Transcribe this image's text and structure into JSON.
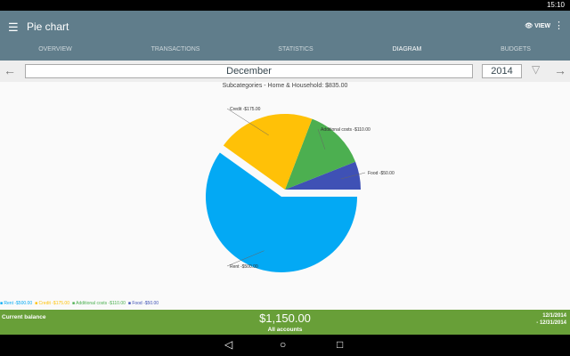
{
  "status": {
    "time": "15:10"
  },
  "appbar": {
    "title": "Pie chart",
    "view_label": "VIEW"
  },
  "tabs": [
    {
      "label": "OVERVIEW"
    },
    {
      "label": "TRANSACTIONS"
    },
    {
      "label": "STATISTICS"
    },
    {
      "label": "DIAGRAM"
    },
    {
      "label": "BUDGETS"
    }
  ],
  "period": {
    "month": "December",
    "year": "2014"
  },
  "chart_data": {
    "type": "pie",
    "title": "Subcategories - Home & Household: $835.00",
    "slices": [
      {
        "name": "Food",
        "value": 50,
        "label": "Food -$50.00",
        "color": "#3f51b5"
      },
      {
        "name": "Additional costs",
        "value": 110,
        "label": "Additional costs -$110.00",
        "color": "#4caf50"
      },
      {
        "name": "Credit",
        "value": 175,
        "label": "Credit -$175.00",
        "color": "#ffc107"
      },
      {
        "name": "Rent",
        "value": 500,
        "label": "Rent -$500.00",
        "color": "#03a9f4",
        "exploded": true
      }
    ],
    "legend_position": "bottom-left"
  },
  "footer": {
    "label": "Current balance",
    "balance": "$1,150.00",
    "accounts": "All accounts",
    "date_from": "12/1/2014",
    "date_to": "- 12/31/2014"
  }
}
